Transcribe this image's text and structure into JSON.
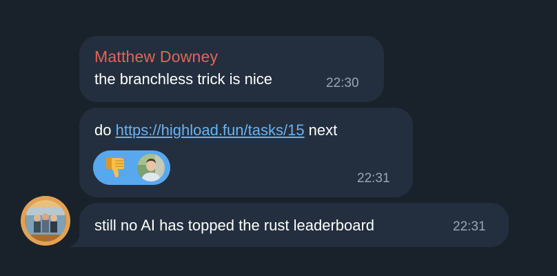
{
  "messages": [
    {
      "sender": "Matthew Downey",
      "text": "the branchless trick is nice",
      "time": "22:30"
    },
    {
      "text_before": "do ",
      "link": "https://highload.fun/tasks/15",
      "text_after": " next",
      "reaction": {
        "emoji_icon": "thumbs-down-icon",
        "color": "#58a8f0"
      },
      "time": "22:31"
    },
    {
      "text": "still no AI has topped the rust leaderboard",
      "time": "22:31"
    }
  ],
  "colors": {
    "background": "#19212b",
    "bubble": "#232f3e",
    "sender_name": "#e3645a",
    "link": "#6ab3f3",
    "timestamp": "#9aa6b4"
  }
}
